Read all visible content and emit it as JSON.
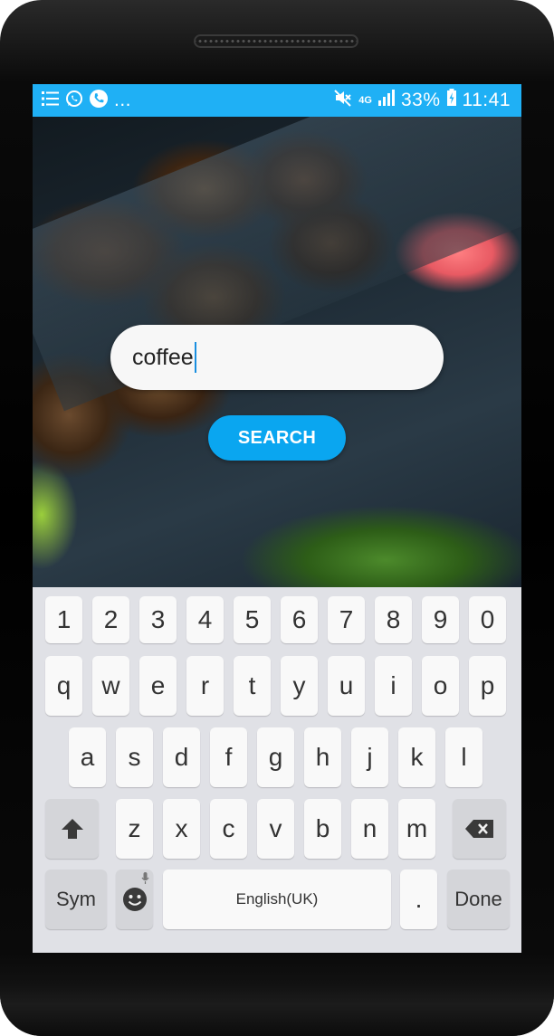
{
  "status_bar": {
    "battery_percent": "33%",
    "time": "11:41",
    "network": "4G",
    "overflow": "...",
    "icons": [
      "list-icon",
      "whatsapp-icon",
      "phone-icon",
      "mute-icon",
      "signal-icon",
      "battery-charging-icon"
    ]
  },
  "search": {
    "input_value": "coffee",
    "button_label": "SEARCH"
  },
  "keyboard": {
    "row_numbers": [
      "1",
      "2",
      "3",
      "4",
      "5",
      "6",
      "7",
      "8",
      "9",
      "0"
    ],
    "row_1": [
      "q",
      "w",
      "e",
      "r",
      "t",
      "y",
      "u",
      "i",
      "o",
      "p"
    ],
    "row_2": [
      "a",
      "s",
      "d",
      "f",
      "g",
      "h",
      "j",
      "k",
      "l"
    ],
    "row_3": [
      "z",
      "x",
      "c",
      "v",
      "b",
      "n",
      "m"
    ],
    "sym_label": "Sym",
    "space_label": "English(UK)",
    "period_label": ".",
    "done_label": "Done"
  },
  "colors": {
    "status_bar": "#1fb0f5",
    "search_button": "#0aa6f0",
    "caret": "#1a8fe0",
    "keyboard_bg": "#e0e1e6"
  }
}
